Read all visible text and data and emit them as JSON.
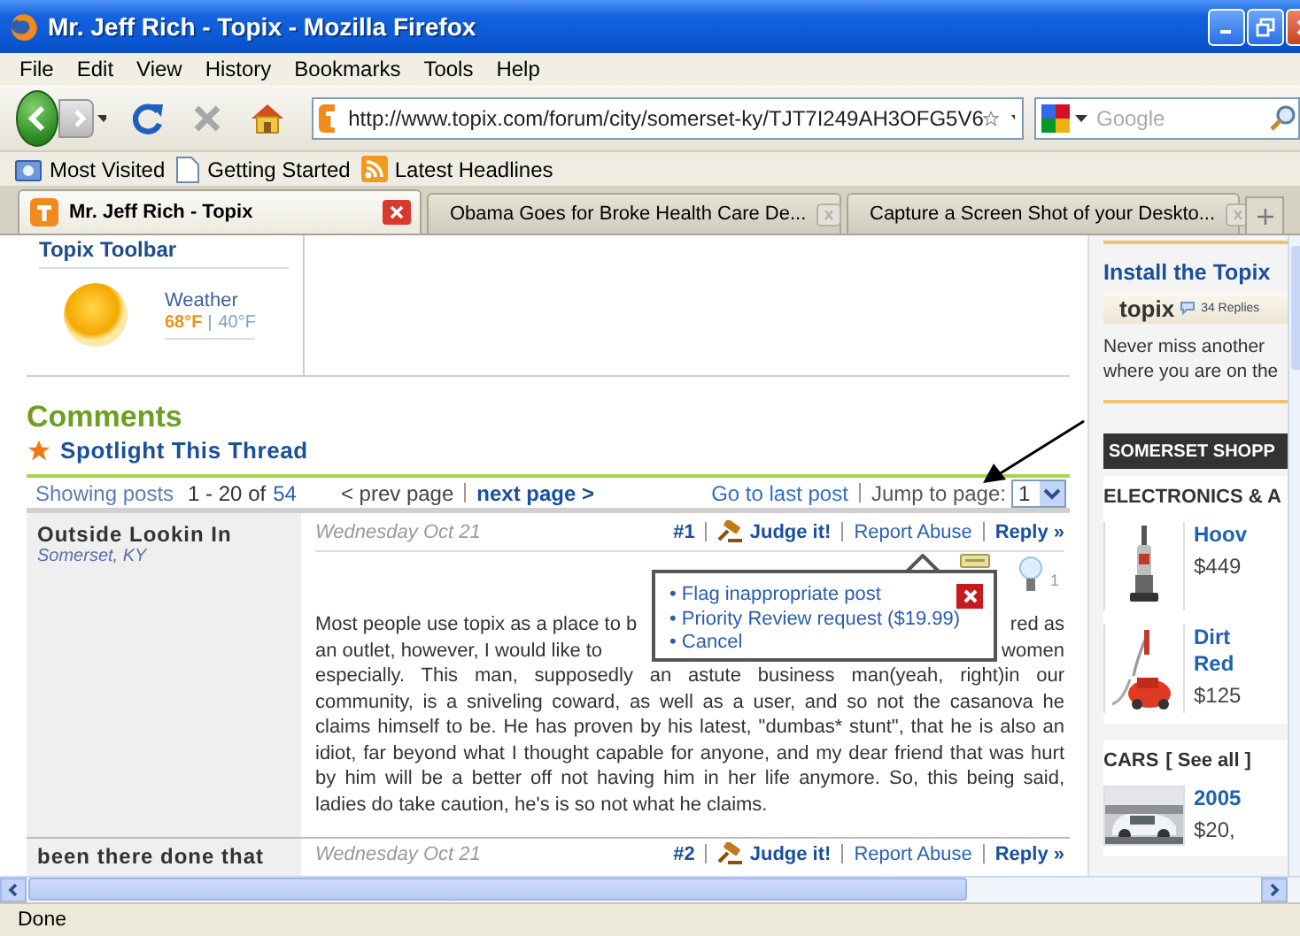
{
  "window": {
    "title": "Mr. Jeff Rich - Topix - Mozilla Firefox"
  },
  "menu": [
    "File",
    "Edit",
    "View",
    "History",
    "Bookmarks",
    "Tools",
    "Help"
  ],
  "navigation": {
    "url": "http://www.topix.com/forum/city/somerset-ky/TJT7I249AH3OFG5V6",
    "search_placeholder": "Google"
  },
  "bookmarks": [
    {
      "label": "Most Visited",
      "kind": "folder"
    },
    {
      "label": "Getting Started",
      "kind": "page"
    },
    {
      "label": "Latest Headlines",
      "kind": "feed"
    }
  ],
  "tabs": [
    {
      "label": "Mr. Jeff Rich - Topix",
      "selected": true
    },
    {
      "label": "Obama Goes for Broke Health Care De...",
      "selected": false
    },
    {
      "label": "Capture a Screen Shot of your Deskto...",
      "selected": false
    }
  ],
  "page": {
    "toolbar_heading": "Topix Toolbar",
    "weather": {
      "label": "Weather",
      "high": "68°F",
      "low": "40°F"
    },
    "comments": {
      "heading": "Comments",
      "spotlight": "Spotlight This Thread"
    },
    "pagination": {
      "showing": "Showing posts",
      "range": "1 - 20 of",
      "total": "54",
      "prev": "< prev page",
      "next": "next page >",
      "last": "Go to last post",
      "jump": "Jump to page:",
      "page": "1"
    },
    "posts": [
      {
        "author": "Outside Lookin In",
        "location": "Somerset, KY",
        "date": "Wednesday Oct 21",
        "number": "#1",
        "judge": "Judge it!",
        "report": "Report Abuse",
        "reply": "Reply »",
        "likes": "1",
        "lines": [
          {
            "kind": "split",
            "left": "Most people use topix as a place to b",
            "right": "red as"
          },
          {
            "kind": "split",
            "left": "an outlet, however, I would like to",
            "right": "women"
          },
          {
            "kind": "full",
            "text": "especially. This man, supposedly an astute business man(yeah, right)in our"
          },
          {
            "kind": "full",
            "text": "community, is a sniveling coward, as well as a user, and so not the casanova he"
          },
          {
            "kind": "full",
            "text": "claims himself to be. He has proven by his latest, \"dumbas* stunt\", that he is also an"
          },
          {
            "kind": "full",
            "text": "idiot, far beyond what I thought capable for anyone, and my dear friend that was hurt"
          },
          {
            "kind": "full",
            "text": "by him will be a better off not having him in her life anymore. So, this being said,"
          },
          {
            "kind": "last",
            "text": "ladies do take caution, he's is so not what he claims."
          }
        ]
      },
      {
        "author": "been there done that",
        "date": "Wednesday Oct 21",
        "number": "#2",
        "judge": "Judge it!",
        "report": "Report Abuse",
        "reply": "Reply »"
      }
    ],
    "report_menu": {
      "items": [
        "• Flag inappropriate post",
        "• Priority Review request ($19.99)",
        "• Cancel"
      ]
    },
    "annotation": {
      "kind": "arrow"
    }
  },
  "sidebar": {
    "heading": "Install the Topix",
    "toolbar_logo": "topix",
    "toolbar_replies": "34 Replies",
    "text_lines": [
      "Never miss another",
      "where you are on the"
    ],
    "shop_heading": "SOMERSET SHOPP",
    "sections": [
      {
        "heading": "ELECTRONICS & A",
        "items": [
          {
            "title": [
              "Hoov"
            ],
            "price": "$449",
            "kind": "vacuum"
          },
          {
            "title": [
              "Dirt",
              "Red"
            ],
            "price": "$125",
            "kind": "canister"
          }
        ]
      },
      {
        "heading": "CARS",
        "see_all": "[ See all ]",
        "items": [
          {
            "title": [
              "2005"
            ],
            "price": "$20,",
            "kind": "car"
          }
        ]
      }
    ]
  },
  "status_bar": "Done"
}
